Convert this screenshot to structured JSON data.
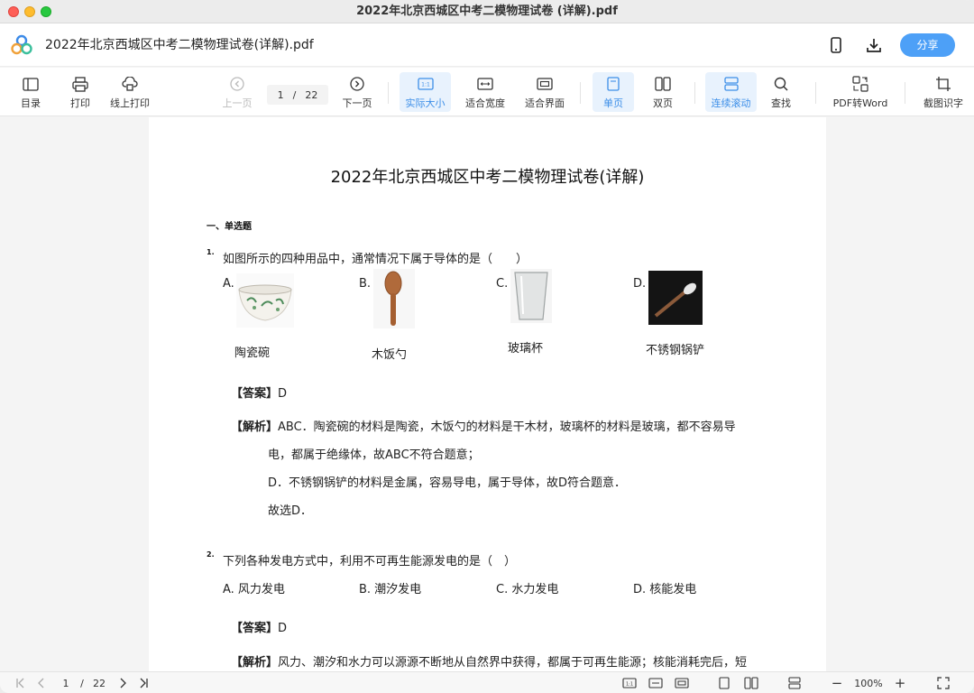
{
  "window": {
    "title": "2022年北京西城区中考二模物理试卷 (详解).pdf"
  },
  "header": {
    "doc_name": "2022年北京西城区中考二模物理试卷(详解).pdf",
    "share_label": "分享"
  },
  "toolbar": {
    "toc": "目录",
    "print": "打印",
    "online_print": "线上打印",
    "prev_page": "上一页",
    "page_current": "1",
    "page_sep": "/",
    "page_total": "22",
    "next_page": "下一页",
    "actual_size": "实际大小",
    "fit_width": "适合宽度",
    "fit_page": "适合界面",
    "single_page": "单页",
    "double_page": "双页",
    "continuous": "连续滚动",
    "search": "查找",
    "pdf_to_word": "PDF转Word",
    "screenshot_ocr": "截图识字"
  },
  "doc": {
    "title": "2022年北京西城区中考二模物理试卷(详解)",
    "section": "一、单选题",
    "q1": {
      "num": "1.",
      "text": "如图所示的四种用品中，通常情况下属于导体的是（　　）",
      "options": [
        {
          "letter": "A.",
          "caption": "陶瓷碗"
        },
        {
          "letter": "B.",
          "caption": "木饭勺"
        },
        {
          "letter": "C.",
          "caption": "玻璃杯"
        },
        {
          "letter": "D.",
          "caption": "不锈钢锅铲"
        }
      ],
      "answer_label": "【答案】",
      "answer": "D",
      "analysis_label": "【解析】",
      "analysis_lines": [
        "ABC．陶瓷碗的材料是陶瓷，木饭勺的材料是干木材，玻璃杯的材料是玻璃，都不容易导",
        "电，都属于绝缘体，故ABC不符合题意；",
        "D．不锈钢锅铲的材料是金属，容易导电，属于导体，故D符合题意．",
        "故选D．"
      ]
    },
    "q2": {
      "num": "2.",
      "text": "下列各种发电方式中，利用不可再生能源发电的是（　）",
      "options": [
        "A. 风力发电",
        "B. 潮汐发电",
        "C. 水力发电",
        "D. 核能发电"
      ],
      "answer_label": "【答案】",
      "answer": "D",
      "analysis_label": "【解析】",
      "analysis_line": "风力、潮汐和水力可以源源不断地从自然界中获得，都属于可再生能源；核能消耗完后，短"
    }
  },
  "bottombar": {
    "page_current": "1",
    "page_sep": "/",
    "page_total": "22",
    "zoom": "100%",
    "zoom_minus": "−",
    "zoom_plus": "+"
  }
}
